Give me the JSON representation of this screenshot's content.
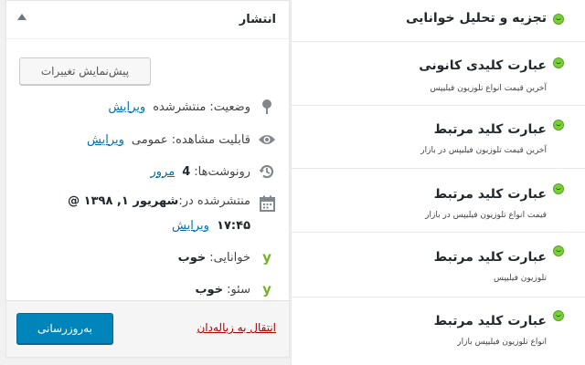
{
  "publish": {
    "title": "انتشار",
    "preview_label": "پیش‌نمایش تغییرات",
    "status": {
      "label": "وضعیت:",
      "value": "منتشرشده",
      "edit": "ویرایش"
    },
    "visibility": {
      "label": "قابلیت مشاهده:",
      "value": "عمومی",
      "edit": "ویرایش"
    },
    "revisions": {
      "label": "رونوشت‌ها:",
      "value": "4",
      "link": "مرور"
    },
    "published_on": {
      "label": "منتشرشده در:",
      "date": "شهریور ۱, ۱۳۹۸ @",
      "time": "۱۷:۴۵",
      "edit": "ویرایش"
    },
    "readability": {
      "label": "خوانایی:",
      "value": "خوب"
    },
    "seo": {
      "label": "سئو:",
      "value": "خوب"
    },
    "trash_label": "انتقال به زباله‌دان",
    "update_label": "به‌روزرسانی"
  },
  "analysis": {
    "header": "تجزیه و تحلیل خوانایی",
    "items": [
      {
        "title": "عبارت کلیدی کانونی",
        "sub": "آخرین قیمت انواع تلوزیون فیلیپس"
      },
      {
        "title": "عبارت کلید مرتبط",
        "sub": "آخرین قیمت تلوزیون فیلیپس در بازار"
      },
      {
        "title": "عبارت کلید مرتبط",
        "sub": "قیمت انواع تلوزیون فیلیپس در بازار"
      },
      {
        "title": "عبارت کلید مرتبط",
        "sub": "تلوزیون فیلیپس"
      },
      {
        "title": "عبارت کلید مرتبط",
        "sub": "انواع تلوزیون فیلیپس بازار"
      }
    ]
  },
  "icons": {
    "status": "pin-icon",
    "visibility": "eye-icon",
    "revisions": "history-icon",
    "published": "calendar-icon",
    "readability": "yoast-icon",
    "seo": "yoast-icon",
    "analysis": "smiley-icon",
    "toggle": "caret-up-icon"
  },
  "colors": {
    "primary": "#0085ba",
    "link": "#0073aa",
    "trash": "#a00000",
    "good": "#7ad03a",
    "yoast": "#77b227"
  }
}
